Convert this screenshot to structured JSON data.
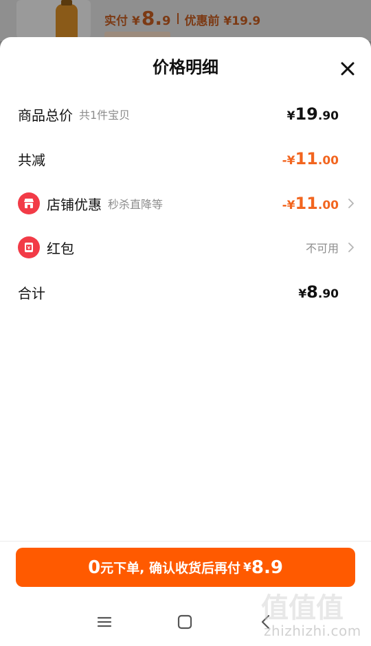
{
  "background": {
    "paid_label": "实付",
    "paid_yen": "¥",
    "paid_int": "8.",
    "paid_dec": "9",
    "original_label": "优惠前 ¥19.9"
  },
  "sheet": {
    "title": "价格明细",
    "close_icon": "close-icon"
  },
  "rows": {
    "subtotal": {
      "label": "商品总价",
      "sub": "共1件宝贝",
      "yen": "¥",
      "int": "19",
      "dec": ".90"
    },
    "total_discount": {
      "label": "共减",
      "sign_yen": "-¥",
      "int": "11",
      "dec": ".00"
    },
    "shop_discount": {
      "label": "店铺优惠",
      "sub": "秒杀直降等",
      "sign_yen": "-¥",
      "int": "11",
      "dec": ".00",
      "icon": "shop-icon"
    },
    "red_packet": {
      "label": "红包",
      "status": "不可用",
      "icon": "red-packet-icon"
    },
    "total": {
      "label": "合计",
      "yen": "¥",
      "int": "8",
      "dec": ".90"
    }
  },
  "cta": {
    "zero": "0",
    "text": "元下单, 确认收货后再付",
    "yen": "¥",
    "amount": "8.9"
  },
  "navbar": {
    "menu_icon": "menu-icon",
    "home_icon": "home-icon",
    "back_icon": "back-icon"
  },
  "watermark": {
    "glyph": "值值值",
    "text": "zhizhizhi.com"
  },
  "colors": {
    "accent_orange": "#ff5a00",
    "discount_orange": "#f2651f",
    "icon_red": "#f23b47"
  }
}
